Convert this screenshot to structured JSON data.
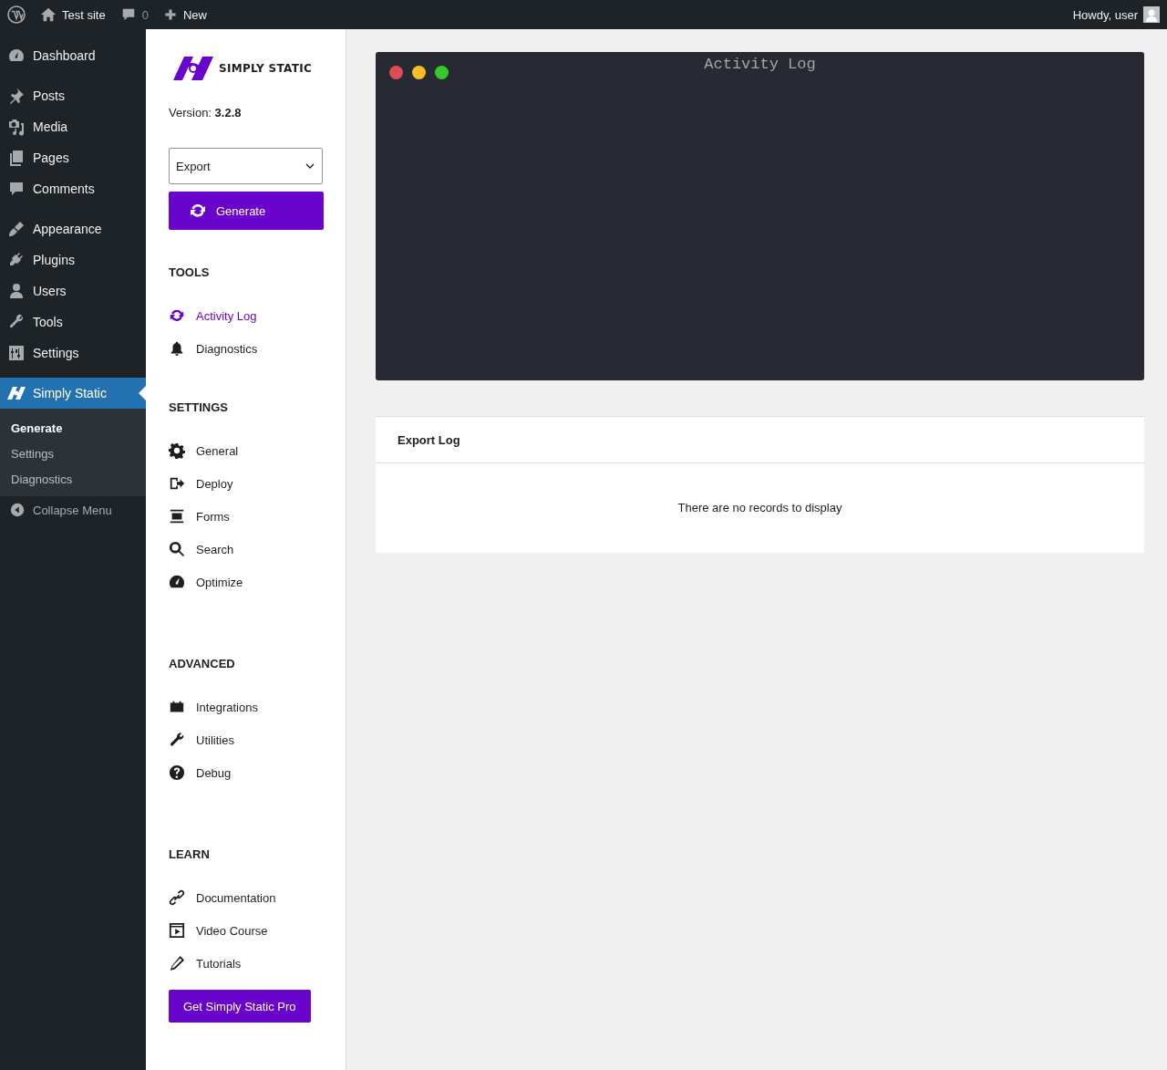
{
  "admin_bar": {
    "site_name": "Test site",
    "comments_count": "0",
    "new_label": "New",
    "greeting": "Howdy, user"
  },
  "admin_menu": {
    "groups": [
      {
        "items": [
          {
            "label": "Dashboard",
            "selected": false
          }
        ]
      },
      {
        "items": [
          {
            "label": "Posts",
            "selected": false
          },
          {
            "label": "Media",
            "selected": false
          },
          {
            "label": "Pages",
            "selected": false
          },
          {
            "label": "Comments",
            "selected": false
          }
        ]
      },
      {
        "items": [
          {
            "label": "Appearance",
            "selected": false
          },
          {
            "label": "Plugins",
            "selected": false
          },
          {
            "label": "Users",
            "selected": false
          },
          {
            "label": "Tools",
            "selected": false
          },
          {
            "label": "Settings",
            "selected": false
          }
        ]
      },
      {
        "items": [
          {
            "label": "Simply Static",
            "selected": true,
            "submenu": [
              {
                "label": "Generate",
                "selected": true
              },
              {
                "label": "Settings",
                "selected": false
              },
              {
                "label": "Diagnostics",
                "selected": false
              }
            ]
          }
        ]
      }
    ],
    "collapse_label": "Collapse Menu"
  },
  "plugin_sidebar": {
    "logo_text": "SIMPLY STATIC",
    "version_label": "Version:",
    "version": "3.2.8",
    "action_select": {
      "value": "Export"
    },
    "generate_button": "Generate",
    "sections": [
      {
        "title": "TOOLS",
        "items": [
          {
            "label": "Activity Log",
            "selected": true
          },
          {
            "label": "Diagnostics",
            "selected": false
          }
        ]
      },
      {
        "title": "SETTINGS",
        "items": [
          {
            "label": "General",
            "selected": false
          },
          {
            "label": "Deploy",
            "selected": false
          },
          {
            "label": "Forms",
            "selected": false
          },
          {
            "label": "Search",
            "selected": false
          },
          {
            "label": "Optimize",
            "selected": false
          }
        ]
      },
      {
        "title": "ADVANCED",
        "items": [
          {
            "label": "Integrations",
            "selected": false
          },
          {
            "label": "Utilities",
            "selected": false
          },
          {
            "label": "Debug",
            "selected": false
          }
        ]
      },
      {
        "title": "LEARN",
        "items": [
          {
            "label": "Documentation",
            "selected": false
          },
          {
            "label": "Video Course",
            "selected": false
          },
          {
            "label": "Tutorials",
            "selected": false
          }
        ]
      }
    ],
    "pro_button": "Get Simply Static Pro"
  },
  "activity_log": {
    "title": "Activity Log"
  },
  "export_log": {
    "title": "Export Log",
    "empty_message": "There are no records to display"
  }
}
